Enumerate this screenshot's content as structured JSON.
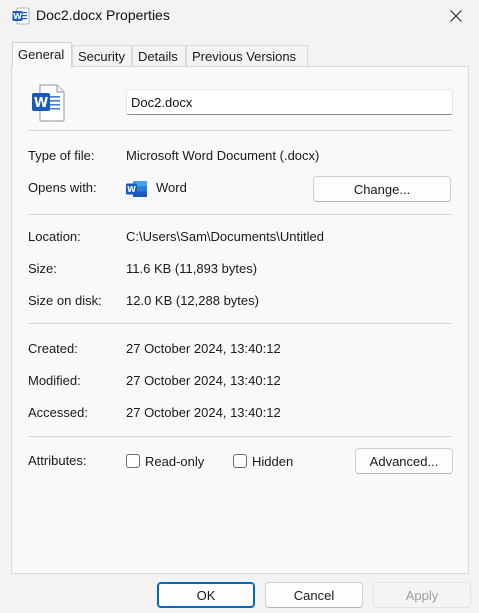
{
  "window": {
    "title": "Doc2.docx Properties",
    "app_icon": "word-icon",
    "close_icon": "close-icon"
  },
  "tabs": [
    {
      "label": "General",
      "active": true
    },
    {
      "label": "Security",
      "active": false
    },
    {
      "label": "Details",
      "active": false
    },
    {
      "label": "Previous Versions",
      "active": false
    }
  ],
  "general": {
    "filename": "Doc2.docx",
    "type_label": "Type of file:",
    "type_value": "Microsoft Word Document (.docx)",
    "opens_label": "Opens with:",
    "opens_value": "Word",
    "change_button": "Change...",
    "location_label": "Location:",
    "location_value": "C:\\Users\\Sam\\Documents\\Untitled",
    "size_label": "Size:",
    "size_value": "11.6 KB (11,893 bytes)",
    "size_disk_label": "Size on disk:",
    "size_disk_value": "12.0 KB (12,288 bytes)",
    "created_label": "Created:",
    "created_value": "27 October 2024, 13:40:12",
    "modified_label": "Modified:",
    "modified_value": "27 October 2024, 13:40:12",
    "accessed_label": "Accessed:",
    "accessed_value": "27 October 2024, 13:40:12",
    "attributes_label": "Attributes:",
    "readonly_label": "Read-only",
    "readonly_checked": false,
    "hidden_label": "Hidden",
    "hidden_checked": false,
    "advanced_button": "Advanced..."
  },
  "footer": {
    "ok": "OK",
    "cancel": "Cancel",
    "apply": "Apply"
  },
  "colors": {
    "word_blue": "#185abd",
    "accent": "#0067c0",
    "disabled_text": "#9d9d9d"
  }
}
